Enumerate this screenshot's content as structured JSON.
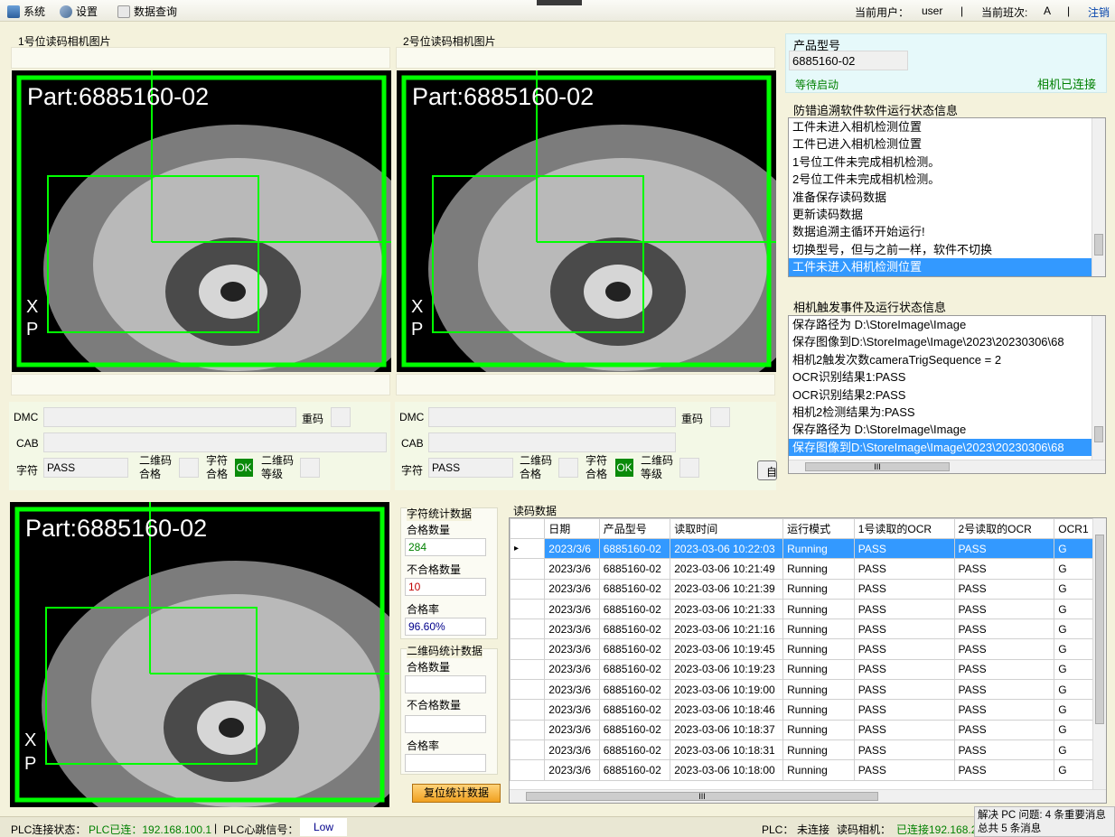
{
  "menu": {
    "system": "系统",
    "settings": "设置",
    "query": "数据查询"
  },
  "user": {
    "user_label": "当前用户：",
    "user": "user",
    "shift_label": "当前班次:",
    "shift": "A",
    "logout": "注销",
    "sep": "|"
  },
  "cam1": {
    "title": "1号位读码相机图片",
    "part": "Part:6885160-02",
    "x": "X",
    "p": "P"
  },
  "cam2": {
    "title": "2号位读码相机图片",
    "part": "Part:6885160-02",
    "x": "X",
    "p": "P"
  },
  "cam3": {
    "part": "Part:6885160-02",
    "x": "X",
    "p": "P"
  },
  "read1": {
    "dmc": "DMC",
    "dup": "重码",
    "cab": "CAB",
    "char_label": "字符",
    "char_value": "PASS",
    "qr_ok": "二维码\n合格",
    "char_ok": "字符\n合格",
    "ok": "OK",
    "qr_grade": "二维码\n等级"
  },
  "read2": {
    "dmc": "DMC",
    "dup": "重码",
    "cab": "CAB",
    "char_label": "字符",
    "char_value": "PASS",
    "qr_ok": "二维码\n合格",
    "char_ok": "字符\n合格",
    "ok": "OK",
    "qr_grade": "二维码\n等级",
    "cut_btn": "自"
  },
  "product": {
    "title": "产品型号",
    "value": "6885160-02",
    "wait": "等待启动",
    "camera": "相机已连接"
  },
  "runlog": {
    "title": "防错追溯软件软件运行状态信息",
    "items": [
      "工件未进入相机检测位置",
      "工件已进入相机检测位置",
      "1号位工件未完成相机检测。",
      "2号位工件未完成相机检测。",
      "准备保存读码数据",
      "更新读码数据",
      "数据追溯主循环开始运行!",
      "切换型号，但与之前一样，软件不切换",
      "工件未进入相机检测位置"
    ]
  },
  "camlog": {
    "title": "相机触发事件及运行状态信息",
    "items": [
      "保存路径为 D:\\StoreImage\\Image",
      "保存图像到D:\\StoreImage\\Image\\2023\\20230306\\68",
      "相机2触发次数cameraTrigSequence = 2",
      "OCR识别结果1:PASS",
      "OCR识别结果2:PASS",
      "相机2检测结果为:PASS",
      "保存路径为 D:\\StoreImage\\Image",
      "保存图像到D:\\StoreImage\\Image\\2023\\20230306\\68"
    ],
    "hbar": "III"
  },
  "charstats": {
    "title": "字符统计数据",
    "ok_label": "合格数量",
    "ok": "284",
    "ng_label": "不合格数量",
    "ng": "10",
    "rate_label": "合格率",
    "rate": "96.60%"
  },
  "qrstats": {
    "title": "二维码统计数据",
    "ok_label": "合格数量",
    "ng_label": "不合格数量",
    "rate_label": "合格率"
  },
  "reset": "复位统计数据",
  "grid": {
    "title": "读码数据",
    "headers": [
      "日期",
      "产品型号",
      "读取时间",
      "运行模式",
      "1号读取的OCR",
      "2号读取的OCR",
      "OCR1"
    ],
    "rows": [
      [
        "2023/3/6",
        "6885160-02",
        "2023-03-06 10:22:03",
        "Running",
        "PASS",
        "PASS",
        "G"
      ],
      [
        "2023/3/6",
        "6885160-02",
        "2023-03-06 10:21:49",
        "Running",
        "PASS",
        "PASS",
        "G"
      ],
      [
        "2023/3/6",
        "6885160-02",
        "2023-03-06 10:21:39",
        "Running",
        "PASS",
        "PASS",
        "G"
      ],
      [
        "2023/3/6",
        "6885160-02",
        "2023-03-06 10:21:33",
        "Running",
        "PASS",
        "PASS",
        "G"
      ],
      [
        "2023/3/6",
        "6885160-02",
        "2023-03-06 10:21:16",
        "Running",
        "PASS",
        "PASS",
        "G"
      ],
      [
        "2023/3/6",
        "6885160-02",
        "2023-03-06 10:19:45",
        "Running",
        "PASS",
        "PASS",
        "G"
      ],
      [
        "2023/3/6",
        "6885160-02",
        "2023-03-06 10:19:23",
        "Running",
        "PASS",
        "PASS",
        "G"
      ],
      [
        "2023/3/6",
        "6885160-02",
        "2023-03-06 10:19:00",
        "Running",
        "PASS",
        "PASS",
        "G"
      ],
      [
        "2023/3/6",
        "6885160-02",
        "2023-03-06 10:18:46",
        "Running",
        "PASS",
        "PASS",
        "G"
      ],
      [
        "2023/3/6",
        "6885160-02",
        "2023-03-06 10:18:37",
        "Running",
        "PASS",
        "PASS",
        "G"
      ],
      [
        "2023/3/6",
        "6885160-02",
        "2023-03-06 10:18:31",
        "Running",
        "PASS",
        "PASS",
        "G"
      ],
      [
        "2023/3/6",
        "6885160-02",
        "2023-03-06 10:18:00",
        "Running",
        "PASS",
        "PASS",
        "G"
      ]
    ],
    "hbar": "III"
  },
  "status": {
    "plc_label": "PLC连接状态：",
    "plc_value": "PLC已连：192.168.100.1",
    "sep": "|",
    "hb_label": "PLC心跳信号：",
    "hb_value": "Low",
    "plc2_label": "PLC：",
    "plc2_value": "未连接",
    "cam_label": "读码相机：",
    "cam_value": "已连接192.168.2"
  },
  "notice": {
    "line1": "解决 PC 问题: 4 条重要消息",
    "line2": "总共 5 条消息"
  },
  "colors": {
    "accent": "#3399ff",
    "ok_green": "#0a8a0a",
    "frame_green": "#00ff00",
    "status_green": "#008000"
  }
}
